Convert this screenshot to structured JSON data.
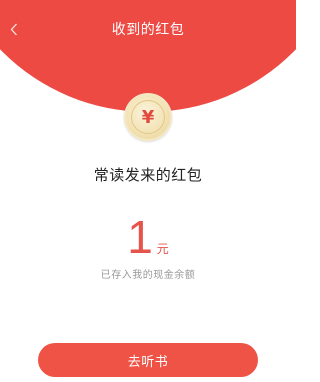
{
  "header": {
    "title": "收到的红包",
    "back_icon": "chevron-left-icon",
    "color": "#ee4a44"
  },
  "coin": {
    "symbol": "¥",
    "icon": "yuan-coin-icon"
  },
  "packet": {
    "from_text": "常读发来的红包",
    "amount": "1",
    "unit": "元",
    "note": "已存入我的现金余额"
  },
  "actions": {
    "primary_label": "去听书",
    "accent_color": "#e5534a"
  }
}
